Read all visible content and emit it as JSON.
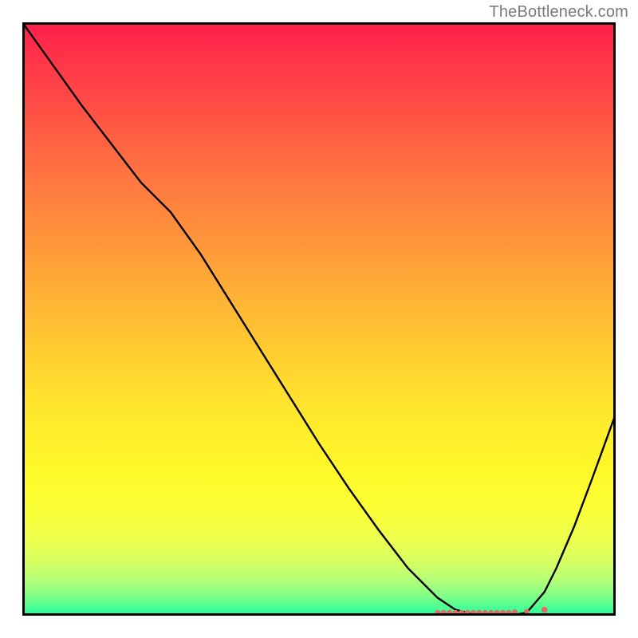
{
  "attribution": "TheBottleneck.com",
  "colors": {
    "curve": "#000000",
    "points": "#e86b63",
    "frame": "#000000"
  },
  "chart_data": {
    "type": "line",
    "title": "",
    "xlabel": "",
    "ylabel": "",
    "xlim": [
      0,
      100
    ],
    "ylim": [
      0,
      100
    ],
    "grid": false,
    "legend": false,
    "series": [
      {
        "name": "bottleneck-curve",
        "x": [
          0,
          5,
          10,
          15,
          20,
          25,
          30,
          35,
          40,
          45,
          50,
          55,
          60,
          65,
          70,
          73,
          77,
          80,
          82,
          85,
          88,
          90,
          93,
          96,
          100
        ],
        "y": [
          100,
          93,
          86,
          79.5,
          73,
          68,
          61,
          53,
          45,
          37,
          29,
          21.5,
          14.5,
          8,
          3,
          1,
          0,
          0,
          0,
          0.5,
          4,
          8,
          15,
          23,
          34
        ]
      }
    ],
    "points_cluster": {
      "name": "optimal-region-markers",
      "x": [
        70,
        71,
        72,
        73,
        74,
        75,
        76,
        77,
        78,
        79,
        80,
        81,
        82,
        83,
        85,
        88
      ],
      "y": [
        0.5,
        0.5,
        0.5,
        0.5,
        0.5,
        0.5,
        0.5,
        0.5,
        0.5,
        0.5,
        0.5,
        0.5,
        0.5,
        0.6,
        0.7,
        1.0
      ],
      "r": [
        3.5,
        3.5,
        3.5,
        3.5,
        3.5,
        3.5,
        3.5,
        3.5,
        3.5,
        3.5,
        3.5,
        3.5,
        3.5,
        3.5,
        3.2,
        3.8
      ]
    }
  }
}
